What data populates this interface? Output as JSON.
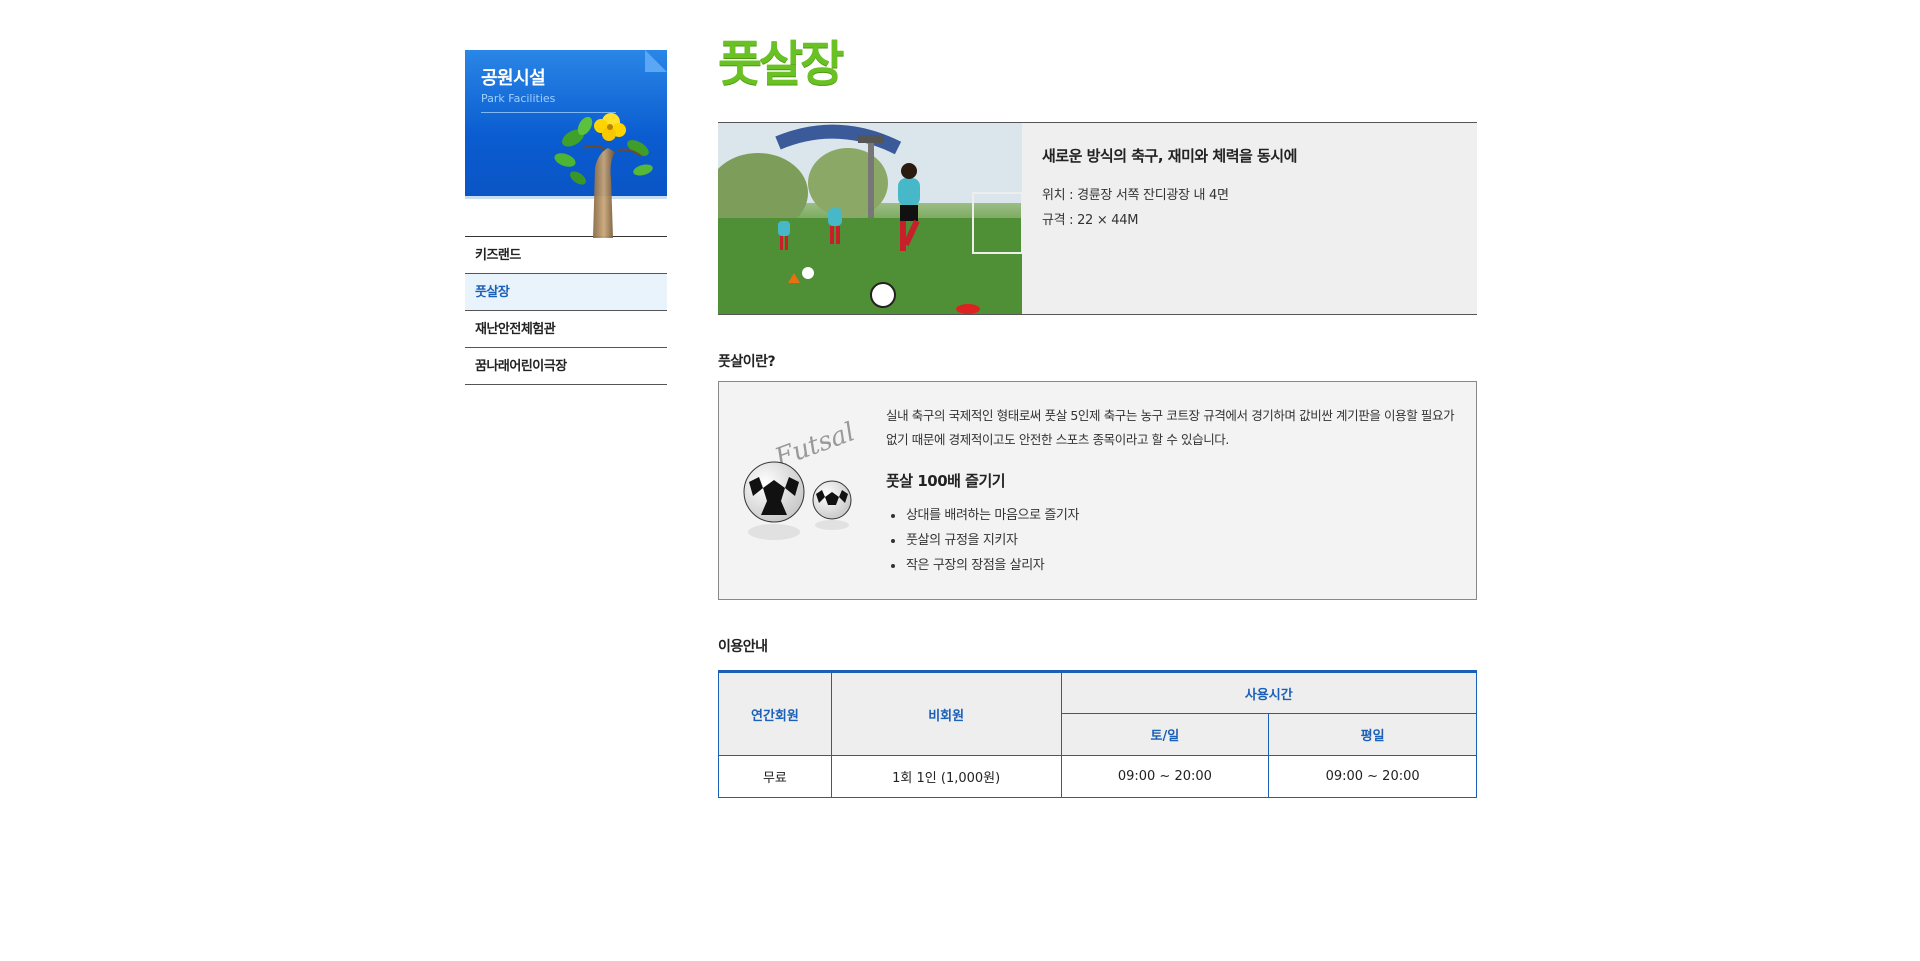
{
  "sidebar": {
    "title": "공원시설",
    "subtitle": "Park Facilities",
    "menu": [
      {
        "label": "키즈랜드",
        "active": false
      },
      {
        "label": "풋살장",
        "active": true
      },
      {
        "label": "재난안전체험관",
        "active": false
      },
      {
        "label": "꿈나래어린이극장",
        "active": false
      }
    ]
  },
  "page": {
    "title": "풋살장"
  },
  "intro": {
    "heading": "새로운 방식의 축구, 재미와 체력을 동시에",
    "location": "위치 : 경륜장 서쪽 잔디광장 내 4면",
    "size": "규격 : 22 × 44M"
  },
  "futsal": {
    "section_title": "풋살이란?",
    "image_text": "Futsal",
    "description": "실내 축구의 국제적인 형태로써 풋살 5인제 축구는 농구 코트장 규격에서 경기하며 값비싼 계기판을 이용할 필요가 없기 때문에 경제적이고도 안전한 스포츠 종목이라고 할 수 있습니다.",
    "sub_title": "풋살 100배 즐기기",
    "tips": [
      "상대를 배려하는 마음으로 즐기자",
      "풋살의 규정을 지키자",
      "작은 구장의 장점을 살리자"
    ]
  },
  "usage": {
    "section_title": "이용안내",
    "headers": {
      "annual": "연간회원",
      "nonmember": "비회원",
      "hours": "사용시간",
      "weekend": "토/일",
      "weekday": "평일"
    },
    "row": {
      "annual": "무료",
      "nonmember": "1회 1인 (1,000원)",
      "weekend": "09:00 ~ 20:00",
      "weekday": "09:00 ~ 20:00"
    }
  },
  "colors": {
    "accent_blue": "#1a5fb8",
    "title_green": "#6ac124",
    "banner_blue": "#0a5cd0"
  }
}
